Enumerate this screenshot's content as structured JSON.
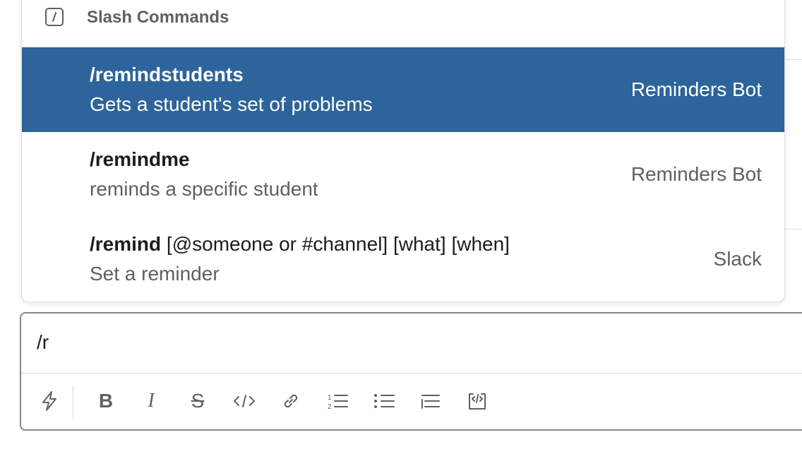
{
  "popup": {
    "header_title": "Slash Commands",
    "header_icon": "slash-command-icon",
    "commands": [
      {
        "name": "/remindstudents",
        "args": "",
        "description": "Gets a student's set of problems",
        "source": "Reminders Bot",
        "selected": true
      },
      {
        "name": "/remindme",
        "args": "",
        "description": "reminds a specific student",
        "source": "Reminders Bot",
        "selected": false
      },
      {
        "name": "/remind",
        "args": "[@someone or #channel] [what] [when]",
        "description": "Set a reminder",
        "source": "Slack",
        "selected": false
      }
    ]
  },
  "composer": {
    "input_value": "/r",
    "toolbar": [
      {
        "icon": "shortcuts-lightning-icon"
      },
      {
        "icon": "bold-icon"
      },
      {
        "icon": "italic-icon"
      },
      {
        "icon": "strikethrough-icon"
      },
      {
        "icon": "code-icon"
      },
      {
        "icon": "link-icon"
      },
      {
        "icon": "ordered-list-icon"
      },
      {
        "icon": "bulleted-list-icon"
      },
      {
        "icon": "blockquote-icon"
      },
      {
        "icon": "code-block-icon"
      }
    ]
  },
  "colors": {
    "selected_row": "#2c649b",
    "text_primary": "#1d1c1d",
    "text_secondary": "#616061",
    "border": "#868686"
  }
}
